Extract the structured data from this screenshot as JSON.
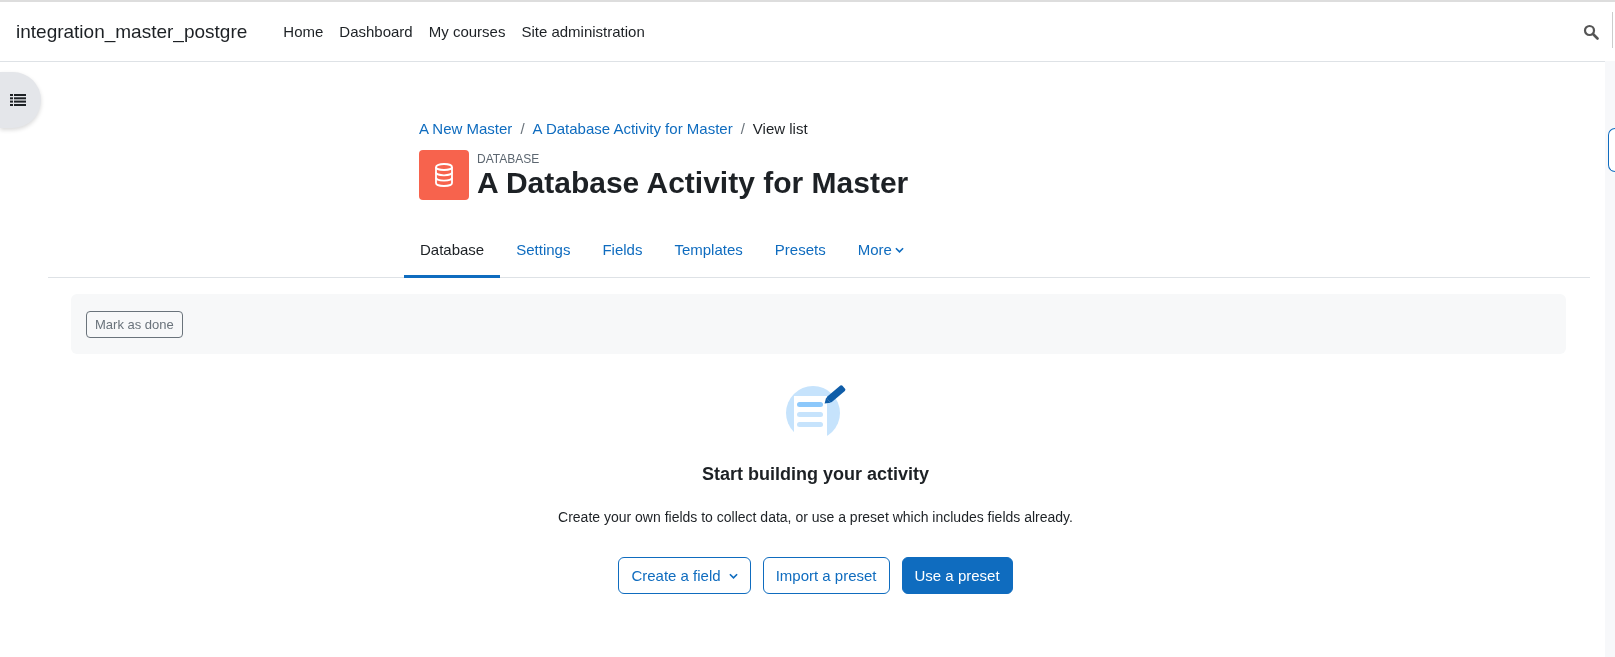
{
  "navbar": {
    "site_name": "integration_master_postgre",
    "links": [
      {
        "label": "Home"
      },
      {
        "label": "Dashboard"
      },
      {
        "label": "My courses"
      },
      {
        "label": "Site administration"
      }
    ]
  },
  "breadcrumb_separator": "/",
  "breadcrumb": [
    {
      "label": "A New Master",
      "kind": "link"
    },
    {
      "label": "A Database Activity for Master",
      "kind": "link"
    },
    {
      "label": "View list",
      "kind": "current"
    }
  ],
  "header": {
    "module_type": "DATABASE",
    "title": "A Database Activity for Master"
  },
  "tabs": [
    {
      "label": "Database",
      "selected": true
    },
    {
      "label": "Settings",
      "selected": false
    },
    {
      "label": "Fields",
      "selected": false
    },
    {
      "label": "Templates",
      "selected": false
    },
    {
      "label": "Presets",
      "selected": false
    },
    {
      "label": "More",
      "selected": false,
      "kind": "dropdown"
    }
  ],
  "completion": {
    "button": "Mark as done"
  },
  "empty_state": {
    "heading": "Start building your activity",
    "text": "Create your own fields to collect data, or use a preset which includes fields already.",
    "buttons": [
      {
        "label": "Create a field",
        "kind": "dropdown"
      },
      {
        "label": "Import a preset",
        "kind": "outline"
      },
      {
        "label": "Use a preset",
        "kind": "primary"
      }
    ]
  }
}
